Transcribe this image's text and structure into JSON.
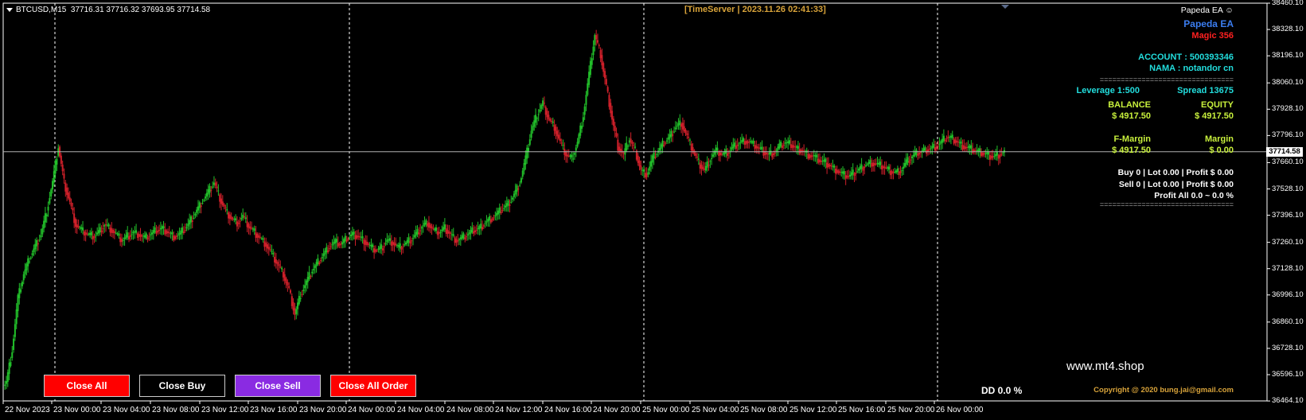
{
  "header": {
    "symbol": "BTCUSD,M15",
    "ohlc": "37716.31 37716.32 37693.95 37714.58"
  },
  "time_server": "[TimeServer | 2023.11.26 02:41:33]",
  "ea_panel": {
    "title": "Papeda EA",
    "name": "Papeda EA",
    "magic": "Magic  356",
    "account": "ACCOUNT : 500393346",
    "nama": "NAMA : notandor cn",
    "divider": "================================",
    "leverage": "Leverage  1:500",
    "spread": "Spread  13675",
    "balance_label": "BALANCE",
    "equity_label": "EQUITY",
    "balance_value": "$ 4917.50",
    "equity_value": "$ 4917.50",
    "fmargin_label": "F-Margin",
    "margin_label": "Margin",
    "fmargin_value": "$ 4917.50",
    "margin_value": "$ 0.00",
    "buy_line": "Buy   0  |  Lot 0.00  |  Profit $ 0.00",
    "sell_line": "Sell   0  |  Lot 0.00  |  Profit $ 0.00",
    "profit_all": "Profit All 0.0 ~ 0.0 %",
    "divider2": "================================",
    "website": "www.mt4.shop",
    "dd": "DD 0.0 %",
    "copyright": "Copyright @ 2020 bung.jai@gmail.com"
  },
  "buttons": {
    "close_all": "Close All",
    "close_buy": "Close Buy",
    "close_sell": "Close Sell",
    "close_all_order": "Close All Order"
  },
  "colors": {
    "background": "#000000",
    "bull": "#22c02a",
    "bear": "#d0202a",
    "close_all": "#ff0000",
    "close_buy": "#000000",
    "close_sell": "#8a2be2",
    "close_all_order": "#ff0000",
    "cyan": "#22dddd",
    "yellowgreen": "#c8f03c",
    "blue": "#3b7df0",
    "red": "#ff2020",
    "gold": "#d8a33a"
  },
  "chart_data": {
    "type": "candlestick",
    "symbol": "BTCUSD",
    "timeframe": "M15",
    "current_price": "37714.58",
    "ylim": [
      36464.41,
      38460.1
    ],
    "y_ticks": [
      "38460.10",
      "38328.10",
      "38196.10",
      "38060.10",
      "37928.10",
      "37796.10",
      "37660.10",
      "37528.10",
      "37396.10",
      "37260.10",
      "37128.10",
      "36996.10",
      "36860.10",
      "36728.10",
      "36596.10",
      "36464.10"
    ],
    "x_ticks": [
      "22 Nov 2023",
      "23 Nov 00:00",
      "23 Nov 04:00",
      "23 Nov 08:00",
      "23 Nov 12:00",
      "23 Nov 16:00",
      "23 Nov 20:00",
      "24 Nov 00:00",
      "24 Nov 04:00",
      "24 Nov 08:00",
      "24 Nov 12:00",
      "24 Nov 16:00",
      "24 Nov 20:00",
      "25 Nov 00:00",
      "25 Nov 04:00",
      "25 Nov 08:00",
      "25 Nov 12:00",
      "25 Nov 16:00",
      "25 Nov 20:00",
      "26 Nov 00:00"
    ],
    "day_separators": [
      "23 Nov 00:00",
      "24 Nov 00:00",
      "25 Nov 00:00",
      "26 Nov 00:00"
    ],
    "close_series": [
      36560,
      36720,
      36980,
      37100,
      37180,
      37240,
      37300,
      37420,
      37560,
      37740,
      37560,
      37460,
      37350,
      37320,
      37300,
      37290,
      37310,
      37350,
      37330,
      37300,
      37270,
      37290,
      37310,
      37300,
      37280,
      37300,
      37320,
      37330,
      37310,
      37290,
      37300,
      37330,
      37370,
      37420,
      37470,
      37510,
      37560,
      37480,
      37420,
      37380,
      37360,
      37390,
      37340,
      37310,
      37280,
      37250,
      37200,
      37150,
      37100,
      37020,
      36900,
      37000,
      37060,
      37120,
      37160,
      37200,
      37240,
      37260,
      37250,
      37280,
      37300,
      37290,
      37270,
      37240,
      37220,
      37230,
      37270,
      37260,
      37230,
      37250,
      37270,
      37300,
      37340,
      37360,
      37320,
      37310,
      37330,
      37300,
      37270,
      37280,
      37300,
      37320,
      37330,
      37360,
      37380,
      37400,
      37430,
      37450,
      37500,
      37560,
      37680,
      37820,
      37900,
      37960,
      37880,
      37840,
      37760,
      37700,
      37680,
      37760,
      37900,
      38100,
      38300,
      38200,
      38040,
      37880,
      37740,
      37700,
      37780,
      37720,
      37620,
      37600,
      37680,
      37720,
      37760,
      37790,
      37840,
      37860,
      37790,
      37720,
      37660,
      37620,
      37680,
      37720,
      37700,
      37710,
      37740,
      37760,
      37770,
      37760,
      37740,
      37720,
      37700,
      37710,
      37740,
      37760,
      37750,
      37730,
      37720,
      37700,
      37690,
      37670,
      37660,
      37640,
      37620,
      37600,
      37590,
      37610,
      37630,
      37650,
      37660,
      37650,
      37640,
      37620,
      37610,
      37620,
      37660,
      37690,
      37710,
      37720,
      37730,
      37740,
      37760,
      37790,
      37780,
      37760,
      37740,
      37730,
      37720,
      37710,
      37700,
      37690,
      37700,
      37714.58
    ]
  }
}
